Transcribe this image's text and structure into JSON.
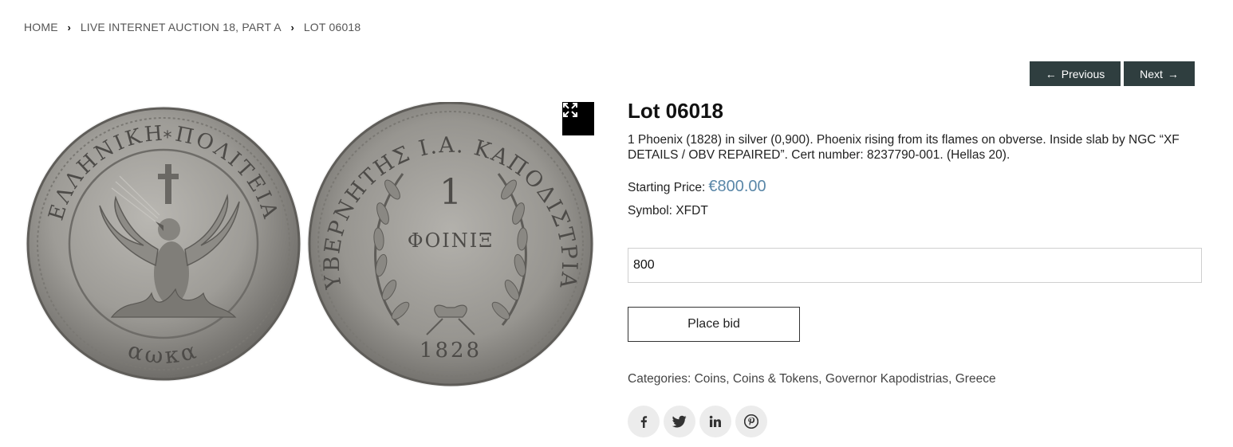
{
  "breadcrumb": {
    "items": [
      "HOME",
      "LIVE INTERNET AUCTION 18, PART A"
    ],
    "current": "LOT 06018"
  },
  "nav": {
    "previous_label": "Previous",
    "next_label": "Next"
  },
  "gallery": {
    "obverse_legend": "ΕΛΛΗΝΙΚΗ ΠΟΛΙΤΕΙΑ",
    "obverse_date": "αωκα",
    "reverse_legend": "ΚΥΒΕΡΝΗΤΗΣ Ι.Α. ΚΑΠΟΔΙΣΤΡΙΑΣ",
    "reverse_denomination_number": "1",
    "reverse_denomination": "ΦΟΙΝΙΞ",
    "reverse_date": "1828"
  },
  "lot": {
    "title": "Lot 06018",
    "description": "1 Phoenix (1828) in silver (0,900). Phoenix rising from its flames on obverse. Inside slab by NGC “XF DETAILS / OBV REPAIRED”. Cert number: 8237790-001. (Hellas 20).",
    "starting_price_label": "Starting Price:",
    "starting_price_value": "€800.00",
    "symbol_label": "Symbol:",
    "symbol_value": "XFDT"
  },
  "bid": {
    "value": "800",
    "button_label": "Place bid"
  },
  "categories": {
    "label": "Categories:",
    "items": [
      "Coins",
      "Coins & Tokens",
      "Governor Kapodistrias",
      "Greece"
    ]
  },
  "share": {
    "icons": [
      "facebook-icon",
      "twitter-icon",
      "linkedin-icon",
      "pinterest-icon"
    ]
  },
  "colors": {
    "nav_button_bg": "#2f3e3f",
    "price_accent": "#5a87a8",
    "coin_silver": "#9a9894"
  }
}
